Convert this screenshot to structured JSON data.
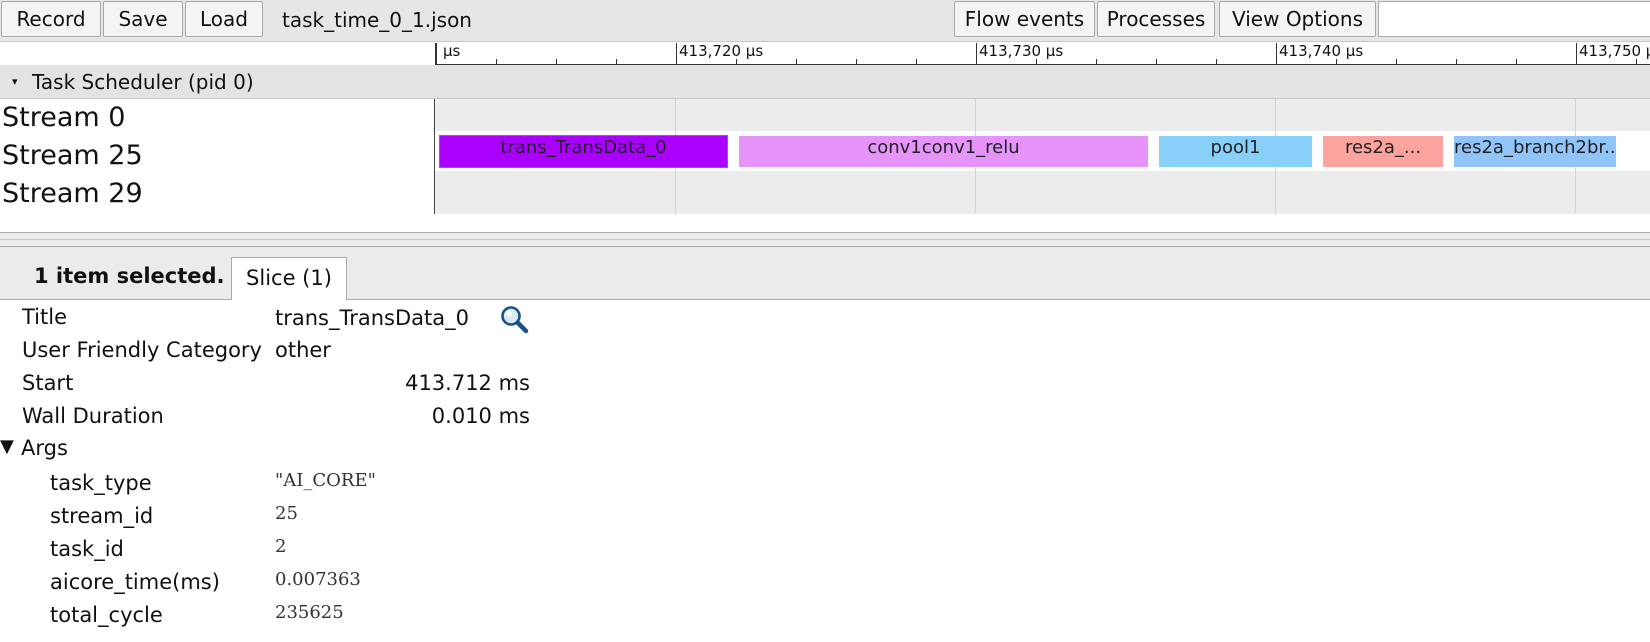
{
  "toolbar": {
    "record_label": "Record",
    "save_label": "Save",
    "load_label": "Load",
    "filename": "task_time_0_1.json",
    "flow_events_label": "Flow events",
    "processes_label": "Processes",
    "view_options_label": "View Options",
    "search_value": ""
  },
  "ruler": {
    "labels": [
      "μs",
      "413,720 μs",
      "413,730 μs",
      "413,740 μs",
      "413,750 μs"
    ]
  },
  "process": {
    "title": "Task Scheduler (pid 0)",
    "arrow": "▾"
  },
  "tracks": [
    {
      "label": "Stream 0"
    },
    {
      "label": "Stream 25"
    },
    {
      "label": "Stream 29"
    }
  ],
  "slices": [
    {
      "name": "trans_TransData_0",
      "color": "#aa00ff",
      "selected": true
    },
    {
      "name": "conv1conv1_relu",
      "color": "#e694fb",
      "selected": false
    },
    {
      "name": "pool1",
      "color": "#88d0fa",
      "selected": false
    },
    {
      "name": "res2a_...",
      "color": "#fba39e",
      "selected": false
    },
    {
      "name": "res2a_branch2br...",
      "color": "#91c4f8",
      "selected": false
    }
  ],
  "panel": {
    "selection_count": "1 item selected.",
    "tab_label": "Slice (1)"
  },
  "details": {
    "title_key": "Title",
    "title_value": "trans_TransData_0",
    "category_key": "User Friendly Category",
    "category_value": "other",
    "start_key": "Start",
    "start_value": "413.712 ms",
    "duration_key": "Wall Duration",
    "duration_value": "0.010 ms",
    "args_key": "Args",
    "args_arrow": "▼",
    "args": [
      {
        "key": "task_type",
        "value": "\"AI_CORE\""
      },
      {
        "key": "stream_id",
        "value": "25"
      },
      {
        "key": "task_id",
        "value": "2"
      },
      {
        "key": "aicore_time(ms)",
        "value": "0.007363"
      },
      {
        "key": "total_cycle",
        "value": "235625"
      }
    ]
  },
  "icons": {
    "search": "magnifier-icon",
    "expand": "triangle-down-icon"
  }
}
